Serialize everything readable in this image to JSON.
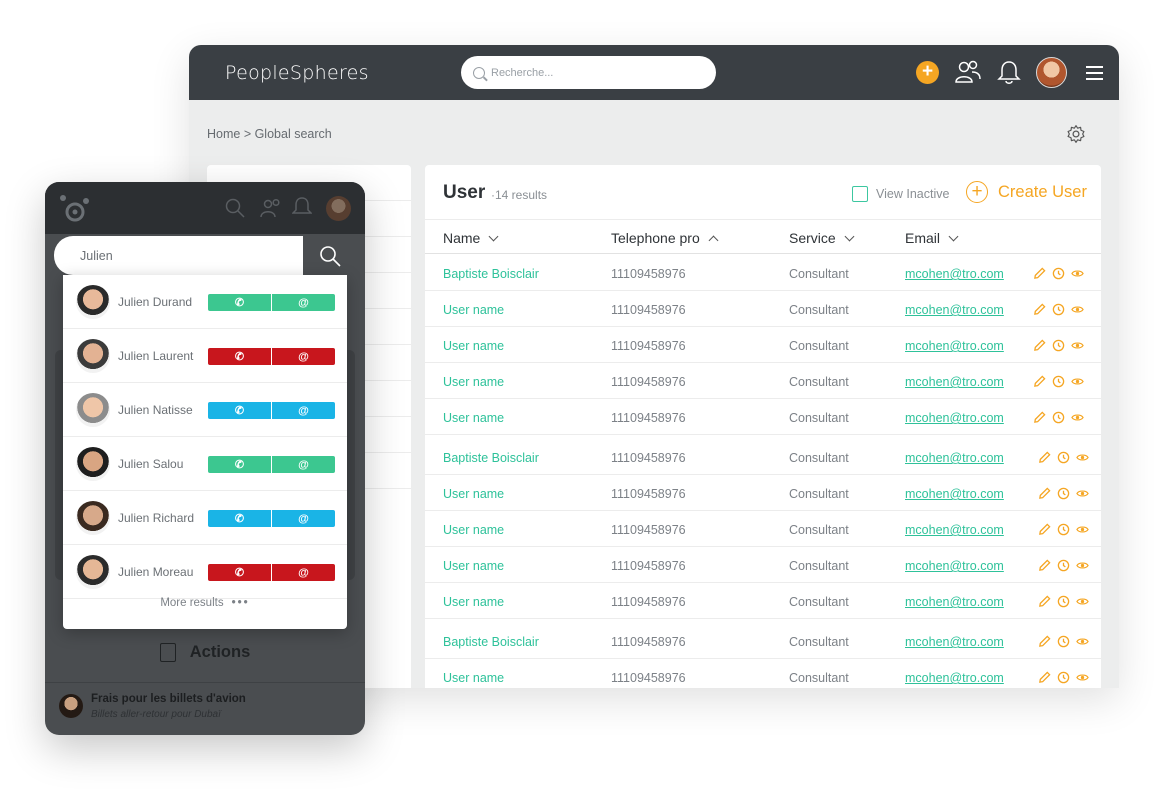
{
  "desktop": {
    "logo": "PeopleSpheres",
    "search_placeholder": "Recherche...",
    "breadcrumb": "Home > Global search",
    "title": "User",
    "count": "·14 results",
    "view_inactive": "View Inactive",
    "create_user": "Create User",
    "columns": [
      "Name",
      "Telephone pro",
      "Service",
      "Email"
    ],
    "rows": [
      {
        "name": "Baptiste Boisclair",
        "phone": "11109458976",
        "service": "Consultant",
        "email": "mcohen@tro.com"
      },
      {
        "name": "User name",
        "phone": "11109458976",
        "service": "Consultant",
        "email": "mcohen@tro.com"
      },
      {
        "name": "User name",
        "phone": "11109458976",
        "service": "Consultant",
        "email": "mcohen@tro.com"
      },
      {
        "name": "User name",
        "phone": "11109458976",
        "service": "Consultant",
        "email": "mcohen@tro.com"
      },
      {
        "name": "User name",
        "phone": "11109458976",
        "service": "Consultant",
        "email": "mcohen@tro.com"
      },
      {
        "name": "Baptiste Boisclair",
        "phone": "11109458976",
        "service": "Consultant",
        "email": "mcohen@tro.com"
      },
      {
        "name": "User name",
        "phone": "11109458976",
        "service": "Consultant",
        "email": "mcohen@tro.com"
      },
      {
        "name": "User name",
        "phone": "11109458976",
        "service": "Consultant",
        "email": "mcohen@tro.com"
      },
      {
        "name": "User name",
        "phone": "11109458976",
        "service": "Consultant",
        "email": "mcohen@tro.com"
      },
      {
        "name": "User name",
        "phone": "11109458976",
        "service": "Consultant",
        "email": "mcohen@tro.com"
      },
      {
        "name": "Baptiste Boisclair",
        "phone": "11109458976",
        "service": "Consultant",
        "email": "mcohen@tro.com"
      },
      {
        "name": "User name",
        "phone": "11109458976",
        "service": "Consultant",
        "email": "mcohen@tro.com"
      }
    ],
    "icons": [
      "plus-icon",
      "users-icon",
      "bell-icon",
      "avatar",
      "menu-icon",
      "gear-icon",
      "pencil-icon",
      "clock-icon",
      "eye-icon"
    ],
    "colors": {
      "accent_green": "#2ec29a",
      "accent_orange": "#f5a623",
      "topbar": "#3a3f44"
    }
  },
  "mobile": {
    "search_value": "Julien",
    "results": [
      {
        "name": "Julien Durand",
        "color": "#3cc790"
      },
      {
        "name": "Julien Laurent",
        "color": "#c8161d"
      },
      {
        "name": "Julien Natisse",
        "color": "#1ab4e6"
      },
      {
        "name": "Julien Salou",
        "color": "#3cc790"
      },
      {
        "name": "Julien Richard",
        "color": "#1ab4e6"
      },
      {
        "name": "Julien Moreau",
        "color": "#c8161d"
      }
    ],
    "call_symbol": "✆",
    "mail_symbol": "@",
    "more_results": "More results",
    "more_dots": "•••",
    "actions": "Actions",
    "notif_title": "Frais pour les billets d'avion",
    "notif_sub": "Billets aller-retour pour Dubaï"
  }
}
